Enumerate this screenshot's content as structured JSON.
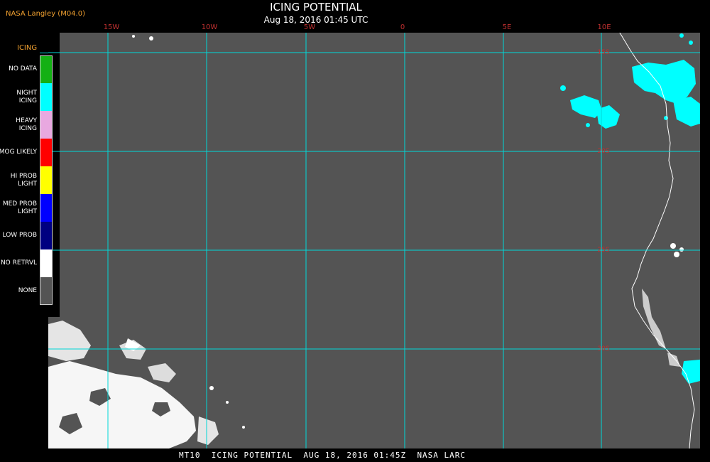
{
  "credit": "NASA Langley (M04.0)",
  "title": "ICING POTENTIAL",
  "subtitle": "Aug 18, 2016 01:45 UTC",
  "legend": {
    "title": "ICING",
    "items": [
      {
        "label": "NO DATA",
        "color": "#14b014"
      },
      {
        "label": "NIGHT ICING",
        "color": "#00ffff"
      },
      {
        "label": "HEAVY ICING",
        "color": "#e8a8e0"
      },
      {
        "label": "MOG LIKELY",
        "color": "#ff0000"
      },
      {
        "label": "HI PROB LIGHT",
        "color": "#ffff00"
      },
      {
        "label": "MED PROB LIGHT",
        "color": "#0000ff"
      },
      {
        "label": "LOW PROB",
        "color": "#000080"
      },
      {
        "label": "NO RETRVL",
        "color": "#ffffff"
      },
      {
        "label": "NONE",
        "color": "#545454"
      }
    ]
  },
  "grid": {
    "lon_labels": [
      "15W",
      "10W",
      "5W",
      "0",
      "5E",
      "10E"
    ],
    "lat_labels": [
      "15S",
      "20S",
      "25S",
      "30S"
    ],
    "line_color": "#00d8d8"
  },
  "footer": {
    "satellite": "MT10",
    "product": "ICING POTENTIAL",
    "datetime": "AUG 18, 2016 01:45Z",
    "agency": "NASA LARC"
  }
}
